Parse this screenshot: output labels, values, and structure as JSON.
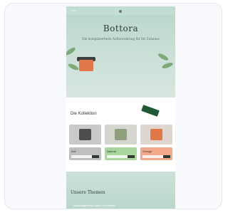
{
  "hero": {
    "topbar_text": "Lizz",
    "brand": "Bottora",
    "subtitle": "Die komplizierteste Aufbewahrung für Ihr Zuhause"
  },
  "collections": {
    "title": "Die Kollektion",
    "products": [
      {
        "label": "Zeit",
        "color": "#c9c9c9",
        "box_color": "#4b4d4e",
        "label_color": "#bfbfbf"
      },
      {
        "label": "Natural",
        "color": "#d6d6cf",
        "box_color": "#8ea07c",
        "label_color": "#a8d69c"
      },
      {
        "label": "Orange",
        "color": "#dfd6cf",
        "box_color": "#e0784a",
        "label_color": "#f4a88b"
      }
    ]
  },
  "section2": {
    "title": "Unsere Themen",
    "text": "Nachhaltigkeit aus Natur und Material"
  }
}
